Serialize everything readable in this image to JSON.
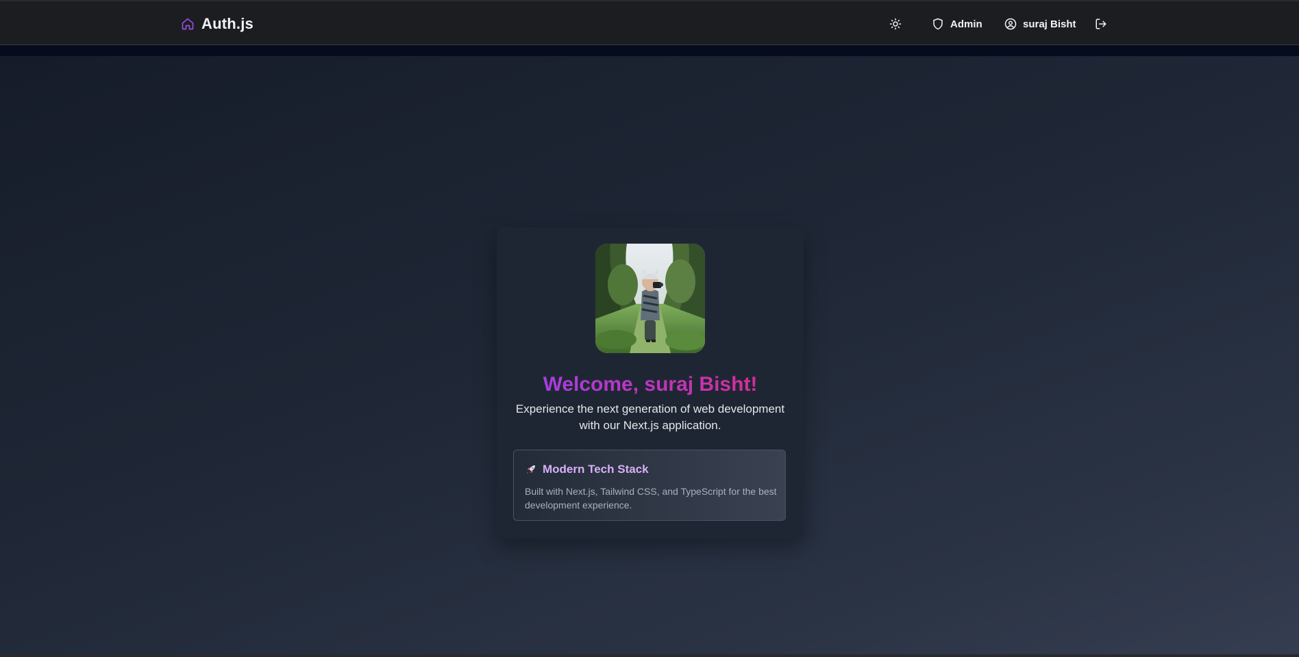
{
  "header": {
    "brand_name": "Auth.js",
    "brand_icon": "home-icon",
    "theme_toggle_icon": "sun-icon",
    "admin_label": "Admin",
    "admin_icon": "shield-icon",
    "user_name": "suraj Bisht",
    "user_icon": "user-circle-icon",
    "logout_icon": "logout-icon"
  },
  "welcome_card": {
    "avatar_description": "child-with-camera-photo",
    "heading": "Welcome, suraj Bisht!",
    "tagline": "Experience the next generation of web development with our Next.js application.",
    "feature": {
      "icon": "rocket-icon",
      "title": "Modern Tech Stack",
      "description": "Built with Next.js, Tailwind CSS, and TypeScript for the best development experience."
    }
  },
  "colors": {
    "accent_purple": "#a63ee0",
    "accent_pink": "#d42d9c",
    "feature_title": "#d6b1f5",
    "navbar_bg": "#1c1d20"
  }
}
